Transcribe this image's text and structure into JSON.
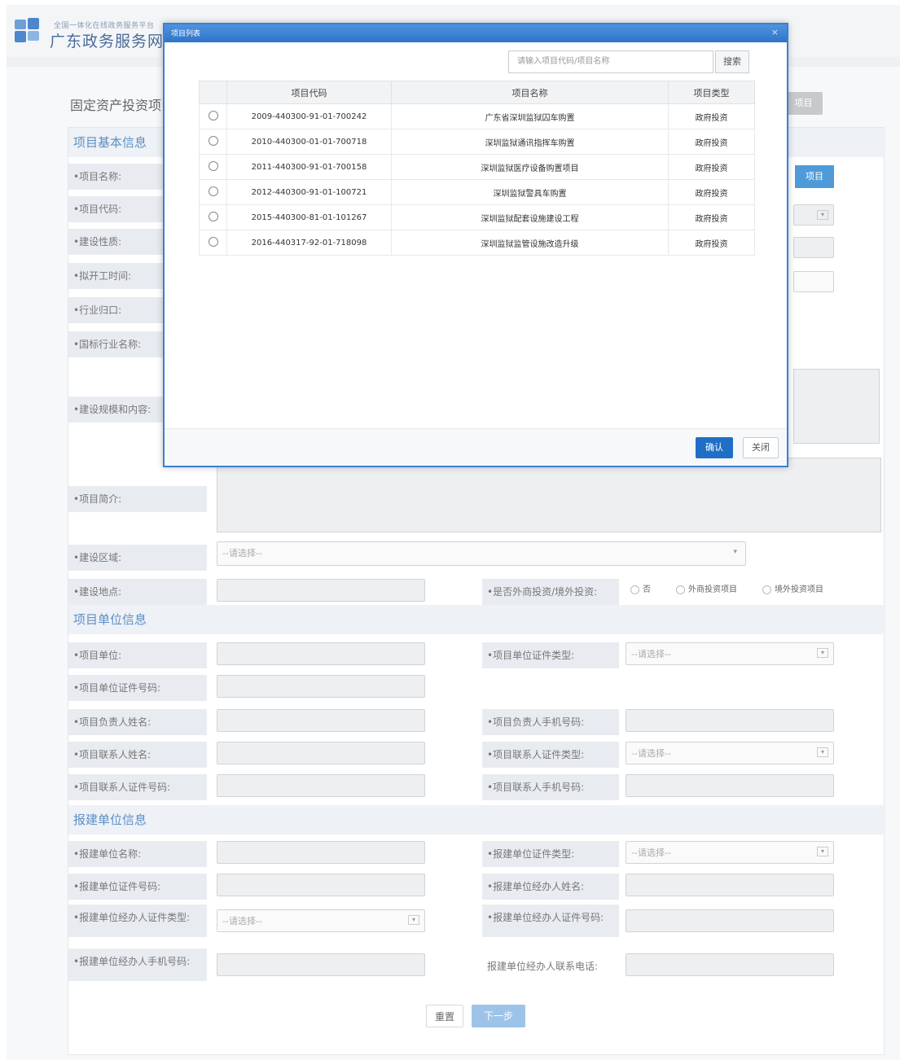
{
  "header": {
    "logo_small": "全国一体化在线政务服务平台",
    "logo_big": "广东政务服务网"
  },
  "page": {
    "title": "固定资产投资项",
    "title_button": "项目"
  },
  "sections": {
    "basic": "项目基本信息",
    "unit": "项目单位信息",
    "report": "报建单位信息"
  },
  "basic_fields": {
    "name": "•项目名称:",
    "code": "•项目代码:",
    "nature": "•建设性质:",
    "start_time": "•拟开工时间:",
    "industry_port": "•行业归口:",
    "national_industry": "•国标行业名称:",
    "scale_content": "•建设规模和内容:",
    "intro": "•项目简介:",
    "region": "•建设区域:",
    "location": "•建设地点:",
    "foreign": "•是否外商投资/境外投资:",
    "select_button": "项目"
  },
  "region_placeholder": "--请选择--",
  "foreign_options": [
    "否",
    "外商投资项目",
    "境外投资项目"
  ],
  "unit_fields": {
    "unit": "•项目单位:",
    "cert_type": "•项目单位证件类型:",
    "cert_no": "•项目单位证件号码:",
    "leader_name": "•项目负责人姓名:",
    "leader_phone": "•项目负责人手机号码:",
    "contact_name": "•项目联系人姓名:",
    "contact_cert_type": "•项目联系人证件类型:",
    "contact_cert_no": "•项目联系人证件号码:",
    "contact_phone": "•项目联系人手机号码:"
  },
  "report_fields": {
    "name": "•报建单位名称:",
    "cert_type": "•报建单位证件类型:",
    "cert_no": "•报建单位证件号码:",
    "agent_name": "•报建单位经办人姓名:",
    "agent_cert_type": "•报建单位经办人证件类型:",
    "agent_cert_no": "•报建单位经办人证件号码:",
    "agent_phone": "•报建单位经办人手机号码:",
    "agent_tel": "报建单位经办人联系电话:"
  },
  "select_placeholder": "--请选择--",
  "footer": {
    "reset": "重置",
    "next": "下一步"
  },
  "modal": {
    "title": "项目列表",
    "close_glyph": "×",
    "search_placeholder": "请输入项目代码/项目名称",
    "search_button": "搜索",
    "columns": [
      "项目代码",
      "项目名称",
      "项目类型"
    ],
    "rows": [
      {
        "code": "2009-440300-91-01-700242",
        "name": "广东省深圳监狱囚车购置",
        "type": "政府投资"
      },
      {
        "code": "2010-440300-01-01-700718",
        "name": "深圳监狱通讯指挥车购置",
        "type": "政府投资"
      },
      {
        "code": "2011-440300-91-01-700158",
        "name": "深圳监狱医疗设备购置项目",
        "type": "政府投资"
      },
      {
        "code": "2012-440300-91-01-100721",
        "name": "深圳监狱警具车购置",
        "type": "政府投资"
      },
      {
        "code": "2015-440300-81-01-101267",
        "name": "深圳监狱配套设施建设工程",
        "type": "政府投资"
      },
      {
        "code": "2016-440317-92-01-718098",
        "name": "深圳监狱监管设施改造升级",
        "type": "政府投资"
      }
    ],
    "confirm": "确认",
    "close": "关闭"
  },
  "colors": {
    "modal_border": "#3a7fd4",
    "confirm_button": "#1f6fc6",
    "section_title": "#5d8fc7",
    "next_button": "#9dc3e8"
  }
}
